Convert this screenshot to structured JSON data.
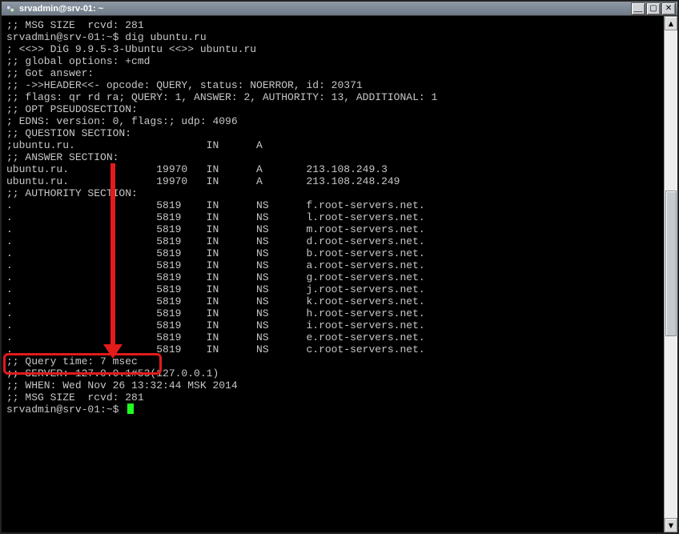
{
  "window": {
    "title": "srvadmin@srv-01: ~"
  },
  "colors": {
    "highlight": "#e21b1b",
    "cursor": "#21ff21"
  },
  "first_msg_size": ";; MSG SIZE  rcvd: 281",
  "prompt1_user": "srvadmin@srv-01:~$ ",
  "prompt1_cmd": "dig ubuntu.ru",
  "banner0": "",
  "banner1": "; <<>> DiG 9.9.5-3-Ubuntu <<>> ubuntu.ru",
  "banner2": ";; global options: +cmd",
  "banner3": ";; Got answer:",
  "banner4": ";; ->>HEADER<<- opcode: QUERY, status: NOERROR, id: 20371",
  "banner5": ";; flags: qr rd ra; QUERY: 1, ANSWER: 2, AUTHORITY: 13, ADDITIONAL: 1",
  "opt_hdr": ";; OPT PSEUDOSECTION:",
  "opt_line": "; EDNS: version: 0, flags:; udp: 4096",
  "q_hdr": ";; QUESTION SECTION:",
  "q_row": {
    "name": ";ubuntu.ru.",
    "class": "IN",
    "type": "A"
  },
  "ans_hdr": ";; ANSWER SECTION:",
  "ans_rows": [
    {
      "name": "ubuntu.ru.",
      "ttl": "19970",
      "class": "IN",
      "type": "A",
      "data": "213.108.249.3"
    },
    {
      "name": "ubuntu.ru.",
      "ttl": "19970",
      "class": "IN",
      "type": "A",
      "data": "213.108.248.249"
    }
  ],
  "auth_hdr": ";; AUTHORITY SECTION:",
  "auth_rows": [
    {
      "name": ".",
      "ttl": "5819",
      "class": "IN",
      "type": "NS",
      "data": "f.root-servers.net."
    },
    {
      "name": ".",
      "ttl": "5819",
      "class": "IN",
      "type": "NS",
      "data": "l.root-servers.net."
    },
    {
      "name": ".",
      "ttl": "5819",
      "class": "IN",
      "type": "NS",
      "data": "m.root-servers.net."
    },
    {
      "name": ".",
      "ttl": "5819",
      "class": "IN",
      "type": "NS",
      "data": "d.root-servers.net."
    },
    {
      "name": ".",
      "ttl": "5819",
      "class": "IN",
      "type": "NS",
      "data": "b.root-servers.net."
    },
    {
      "name": ".",
      "ttl": "5819",
      "class": "IN",
      "type": "NS",
      "data": "a.root-servers.net."
    },
    {
      "name": ".",
      "ttl": "5819",
      "class": "IN",
      "type": "NS",
      "data": "g.root-servers.net."
    },
    {
      "name": ".",
      "ttl": "5819",
      "class": "IN",
      "type": "NS",
      "data": "j.root-servers.net."
    },
    {
      "name": ".",
      "ttl": "5819",
      "class": "IN",
      "type": "NS",
      "data": "k.root-servers.net."
    },
    {
      "name": ".",
      "ttl": "5819",
      "class": "IN",
      "type": "NS",
      "data": "h.root-servers.net."
    },
    {
      "name": ".",
      "ttl": "5819",
      "class": "IN",
      "type": "NS",
      "data": "i.root-servers.net."
    },
    {
      "name": ".",
      "ttl": "5819",
      "class": "IN",
      "type": "NS",
      "data": "e.root-servers.net."
    },
    {
      "name": ".",
      "ttl": "5819",
      "class": "IN",
      "type": "NS",
      "data": "c.root-servers.net."
    }
  ],
  "qtime": ";; Query time: 7 msec",
  "server": ";; SERVER: 127.0.0.1#53(127.0.0.1)",
  "when": ";; WHEN: Wed Nov 26 13:32:44 MSK 2014",
  "msize": ";; MSG SIZE  rcvd: 281",
  "prompt2_user": "srvadmin@srv-01:~$ "
}
